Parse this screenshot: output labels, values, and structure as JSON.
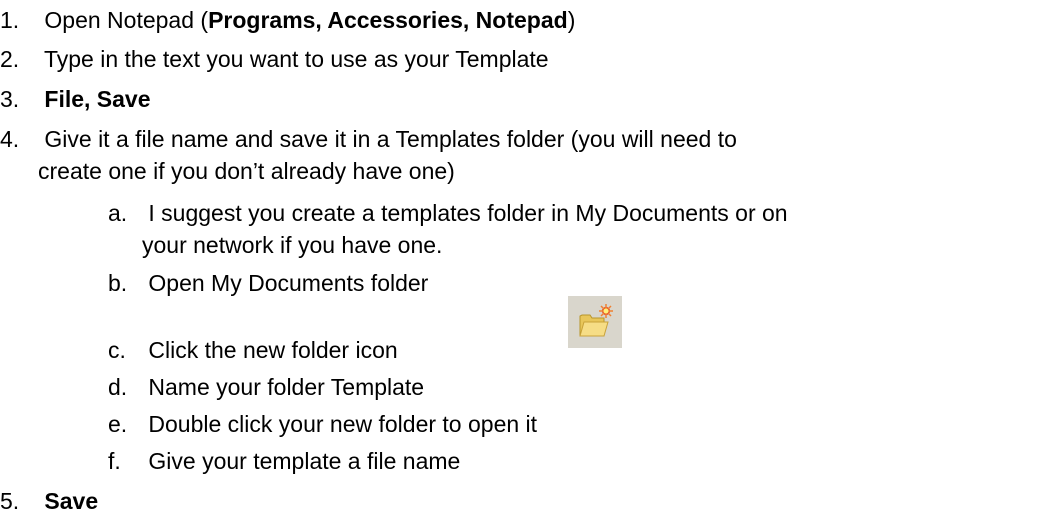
{
  "steps": [
    {
      "num": "1.",
      "parts": [
        "Open Notepad (",
        "Programs, Accessories, Notepad",
        ")"
      ]
    },
    {
      "num": "2.",
      "text": "Type in the text you want to use as your Template"
    },
    {
      "num": "3.",
      "text": "File, Save"
    },
    {
      "num": "4.",
      "line1": "Give it a file name and save it in a Templates folder (you will need to",
      "line2": "create one if you don’t already have one)"
    },
    {
      "num": "5.",
      "text": "Save"
    }
  ],
  "substeps": [
    {
      "letter": "a.",
      "line1": "I suggest you create a templates folder in My Documents or on",
      "line2": "your network if you have one."
    },
    {
      "letter": "b.",
      "text": "Open My Documents folder"
    },
    {
      "letter": "c.",
      "text": "Click the new folder icon"
    },
    {
      "letter": "d.",
      "text": "Name your folder Template"
    },
    {
      "letter": "e.",
      "text": "Double click your new folder to open it"
    },
    {
      "letter": "f.",
      "text": "Give your template a file name"
    }
  ],
  "icon": {
    "name": "new-folder-icon",
    "bg": "#d9d6cc",
    "folder": "#f0d060",
    "star": "#e04020"
  }
}
